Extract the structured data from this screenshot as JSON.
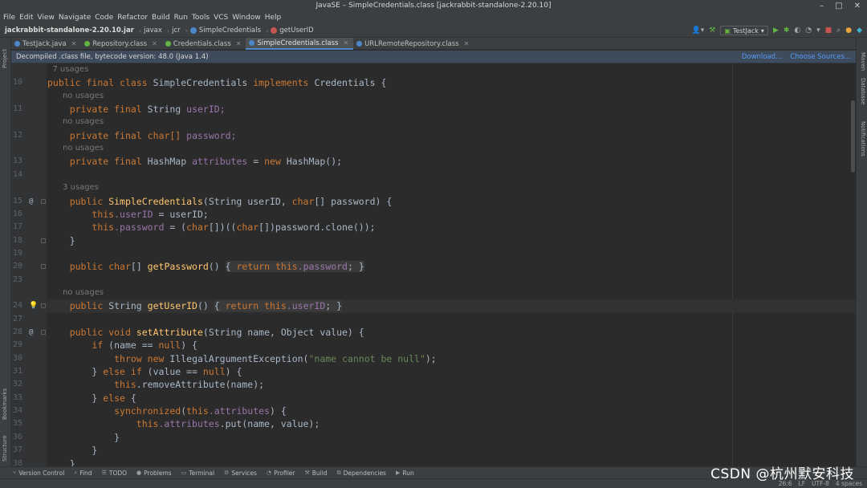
{
  "window": {
    "title": "JavaSE – SimpleCredentials.class [jackrabbit-standalone-2.20.10]"
  },
  "menu": [
    "File",
    "Edit",
    "View",
    "Navigate",
    "Code",
    "Refactor",
    "Build",
    "Run",
    "Tools",
    "VCS",
    "Window",
    "Help"
  ],
  "breadcrumbs": [
    "jackrabbit-standalone-2.20.10.jar",
    "javax",
    "jcr",
    "SimpleCredentials",
    "getUserID"
  ],
  "toolbar": {
    "run_config": "TestJack"
  },
  "tabs": [
    {
      "label": "TestJack.java",
      "color": "#4a88c7"
    },
    {
      "label": "Repository.class",
      "color": "#62b543"
    },
    {
      "label": "Credentials.class",
      "color": "#62b543"
    },
    {
      "label": "SimpleCredentials.class",
      "color": "#4a88c7"
    },
    {
      "label": "URLRemoteRepository.class",
      "color": "#4a88c7"
    }
  ],
  "side_tools": {
    "left_top": "Project",
    "left_bookmarks": "Bookmarks",
    "left_structure": "Structure",
    "right_maven": "Maven",
    "right_database": "Database",
    "right_notifications": "Notifications"
  },
  "banner": {
    "message": "Decompiled .class file, bytecode version: 48.0 (Java 1.4)",
    "download": "Download...",
    "choose_sources": "Choose Sources..."
  },
  "code": {
    "usage_hints": [
      "7 usages",
      "no usages",
      "no usages",
      "no usages",
      "3 usages",
      "no usages"
    ],
    "line_numbers": [
      "10",
      "11",
      "12",
      "13",
      "14",
      "15",
      "16",
      "17",
      "18",
      "19",
      "20",
      "23",
      "24",
      "27",
      "28",
      "29",
      "30",
      "31",
      "32",
      "33",
      "34",
      "35",
      "36",
      "37",
      "38"
    ],
    "lines": {
      "l10": [
        "public",
        "final",
        "class",
        "SimpleCredentials",
        "implements",
        "Credentials",
        "{"
      ],
      "l11": [
        "private",
        "final",
        "String",
        "userID;"
      ],
      "l12": [
        "private",
        "final",
        "char[]",
        "password;"
      ],
      "l13": [
        "private",
        "final",
        "HashMap",
        "attributes",
        "= ",
        "new",
        "HashMap();"
      ],
      "l15": [
        "public",
        "SimpleCredentials",
        "(String userID, ",
        "char",
        "[] password) {"
      ],
      "l16": [
        "this",
        ".userID",
        " = userID;"
      ],
      "l17": [
        "this",
        ".password",
        " = (",
        "char",
        "[])((",
        "char",
        "[])password.clone());"
      ],
      "l18": [
        "}"
      ],
      "l20": [
        "public",
        "char",
        "[] ",
        "getPassword",
        "() ",
        "{ ",
        "return",
        "this",
        ".password",
        "; }"
      ],
      "l24": [
        "public",
        "String ",
        "getUserID",
        "() ",
        "{ ",
        "return",
        "this",
        ".userID",
        "; }"
      ],
      "l28": [
        "public",
        "void",
        "setAttribute",
        "(String name, Object value) {"
      ],
      "l29": [
        "if",
        " (name == ",
        "null",
        ") {"
      ],
      "l30": [
        "throw",
        "new",
        "IllegalArgumentException(",
        "\"name cannot be null\"",
        ");"
      ],
      "l31": [
        "} ",
        "else",
        "if",
        " (value == ",
        "null",
        ") {"
      ],
      "l32": [
        "this",
        ".removeAttribute(name);"
      ],
      "l33": [
        "} ",
        "else",
        " {"
      ],
      "l34": [
        "synchronized",
        "(",
        "this",
        ".attributes",
        ") {"
      ],
      "l35": [
        "this",
        ".attributes",
        ".put(name, value);"
      ],
      "l36": [
        "}"
      ],
      "l37": [
        "}"
      ],
      "l38": [
        "}"
      ]
    }
  },
  "bottom_tools": [
    "Version Control",
    "Find",
    "TODO",
    "Problems",
    "Terminal",
    "Services",
    "Profiler",
    "Build",
    "Dependencies",
    "Run"
  ],
  "status": {
    "position": "26:6",
    "line_sep": "LF",
    "encoding": "UTF-8",
    "indent": "4 spaces"
  },
  "watermark": "CSDN @杭州默安科技",
  "colors": {
    "keyword": "#cc7832",
    "method": "#ffc66d",
    "field": "#9876aa",
    "string": "#6a8759",
    "link": "#589df6"
  }
}
